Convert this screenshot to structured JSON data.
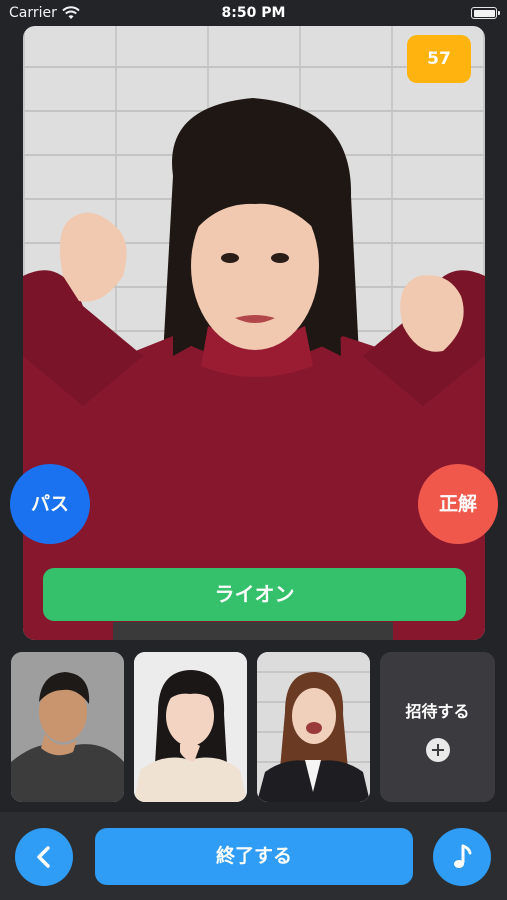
{
  "status_bar": {
    "carrier": "Carrier",
    "time": "8:50 PM",
    "icons": [
      "wifi-icon",
      "battery-icon"
    ]
  },
  "game": {
    "timer": "57",
    "answer": "ライオン",
    "pass_label": "パス",
    "correct_label": "正解",
    "photo": "woman-lion-pose-photo"
  },
  "participants": {
    "tiles": [
      "man-thinking-photo",
      "woman-surprised-photo",
      "woman-laughing-photo"
    ],
    "invite_label": "招待する",
    "invite_icon": "plus-circle-icon"
  },
  "bottom_bar": {
    "back_icon": "chevron-left-icon",
    "end_label": "終了する",
    "music_icon": "music-note-icon"
  },
  "colors": {
    "background": "#232428",
    "timer": "#ffb30f",
    "answer": "#35c16b",
    "pass": "#1a72f0",
    "correct": "#f0584c",
    "primary": "#2f9cf5"
  }
}
